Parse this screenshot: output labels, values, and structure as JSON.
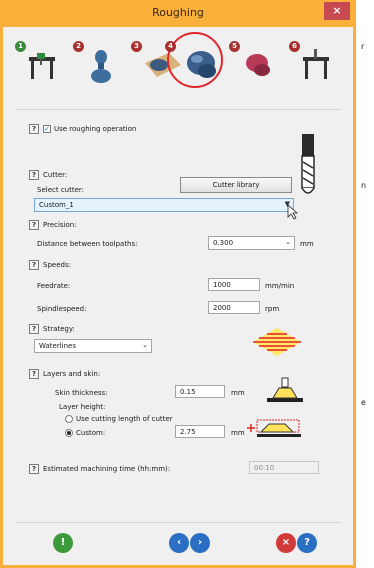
{
  "background": {
    "right_chars": [
      "r",
      "n",
      "e"
    ]
  },
  "window": {
    "title": "Roughing",
    "close_glyph": "×"
  },
  "steps": [
    {
      "num": "1",
      "icon": "machine-icon",
      "color": "#3a8a3a"
    },
    {
      "num": "2",
      "icon": "vase-icon",
      "color": "#a83030"
    },
    {
      "num": "3",
      "icon": "stock-icon",
      "color": "#a83030"
    },
    {
      "num": "4",
      "icon": "roughing-icon",
      "color": "#a83030",
      "active": true
    },
    {
      "num": "5",
      "icon": "finishing-icon",
      "color": "#a83030"
    },
    {
      "num": "6",
      "icon": "output-icon",
      "color": "#a83030"
    }
  ],
  "form": {
    "help_glyph": "?",
    "check_glyph": "✓",
    "use_roughing": "Use roughing operation",
    "cutter_title": "Cutter:",
    "select_cutter": "Select cutter:",
    "cutter_library": "Cutter library",
    "cutter_value": "Custom_1",
    "precision_title": "Precision:",
    "distance_label": "Distance between toolpaths:",
    "distance_value": "0.300",
    "distance_unit": "mm",
    "speeds_title": "Speeds:",
    "feedrate_label": "Feedrate:",
    "feedrate_value": "1000",
    "feedrate_unit": "mm/min",
    "spindle_label": "Spindlespeed:",
    "spindle_value": "2000",
    "spindle_unit": "rpm",
    "strategy_title": "Strategy:",
    "strategy_value": "Waterlines",
    "layers_title": "Layers and skin:",
    "skin_label": "Skin thickness:",
    "skin_value": "0.15",
    "skin_unit": "mm",
    "layer_height": "Layer height:",
    "use_cutting": "Use cutting length of cutter",
    "custom_label": "Custom:",
    "custom_value": "2.75",
    "custom_unit": "mm",
    "est_label": "Estimated machining time (hh:mm):",
    "est_value": "00:10"
  },
  "colors": {
    "title_bar": "#fbb03b",
    "close": "#c74a51",
    "active_ring": "#e0282c"
  }
}
